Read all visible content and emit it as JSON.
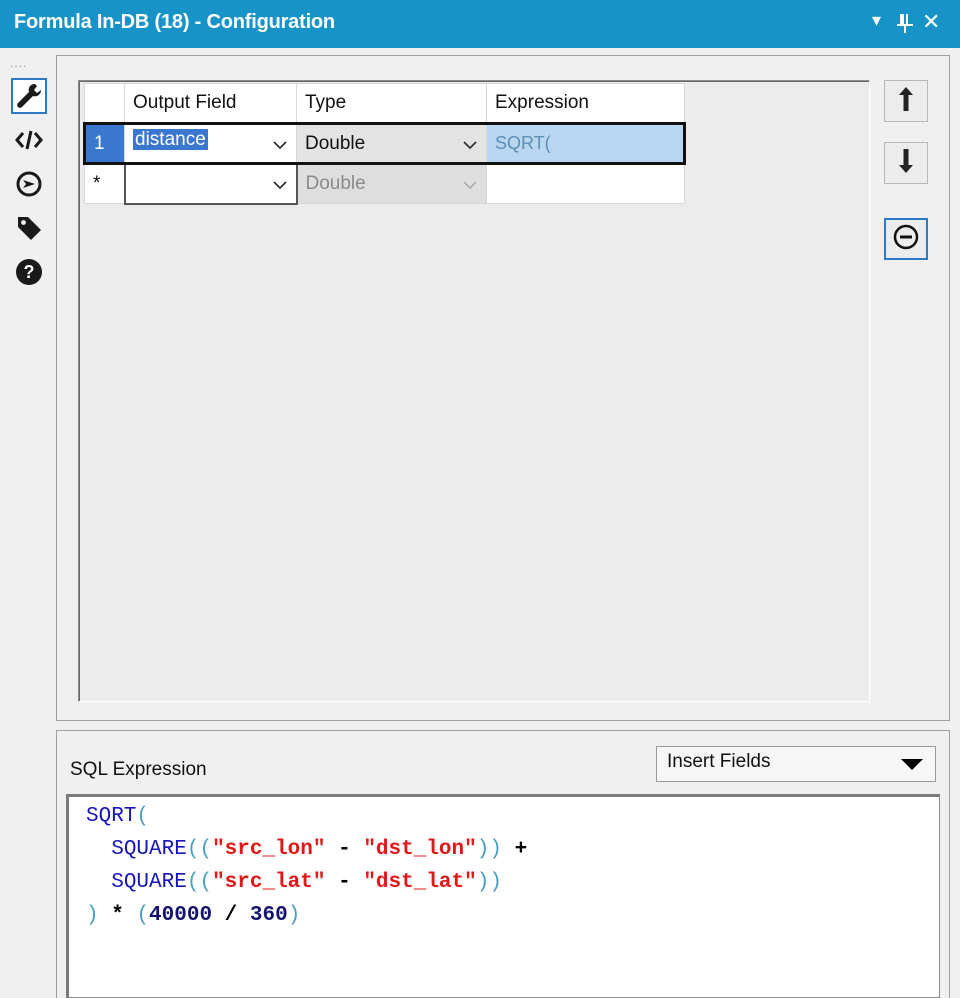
{
  "window": {
    "title": "Formula In-DB (18) - Configuration",
    "controls": {
      "dropdown": "▾",
      "pin": "⊥",
      "close": "✕"
    }
  },
  "rail": {
    "grip": "....",
    "icons": [
      "wrench-icon",
      "code-icon",
      "target-icon",
      "tag-icon",
      "help-icon"
    ]
  },
  "grid": {
    "columns": [
      "Output Field",
      "Type",
      "Expression"
    ],
    "rows": [
      {
        "index": "1",
        "field": "distance",
        "type": "Double",
        "expression": "SQRT("
      },
      {
        "index": "*",
        "field": "",
        "type": "Double",
        "expression": ""
      }
    ]
  },
  "side_buttons": [
    "move-up",
    "move-down",
    "remove"
  ],
  "sql": {
    "label": "SQL Expression",
    "insert_fields": "Insert Fields",
    "code": {
      "l1_fn": "SQRT",
      "l1_paren": "(",
      "l2_fn": "SQUARE",
      "l2_open": "((",
      "l2_a": "\"src_lon\"",
      "l2_minus": "-",
      "l2_b": "\"dst_lon\"",
      "l2_close": "))",
      "l2_plus": "+",
      "l3_fn": "SQUARE",
      "l3_open": "((",
      "l3_a": "\"src_lat\"",
      "l3_minus": "-",
      "l3_b": "\"dst_lat\"",
      "l3_close": "))",
      "l4_close": ")",
      "l4_mul": "*",
      "l4_open": "(",
      "l4_n1": "40000",
      "l4_div": "/",
      "l4_n2": "360",
      "l4_close2": ")"
    }
  },
  "colors": {
    "titlebar": "#1893c8",
    "selection": "#3a78d0",
    "expr_bg": "#b9d7f0"
  }
}
